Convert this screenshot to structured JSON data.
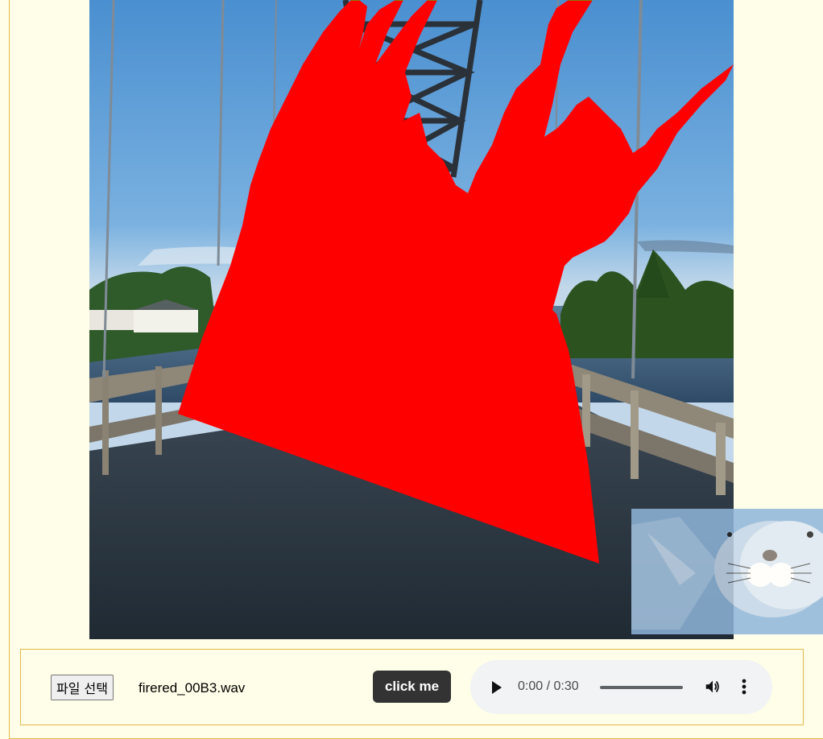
{
  "file_input": {
    "button_label": "파일 선택",
    "file_name": "firered_00B3.wav"
  },
  "action_button": {
    "label": "click me"
  },
  "audio_player": {
    "current_time": "0:00",
    "separator": "/",
    "duration": "0:30",
    "progress_fraction": 0.0,
    "play_icon": "play-icon",
    "volume_icon": "volume-icon",
    "menu_icon": "more-vert-icon"
  },
  "visualizer": {
    "background_scene": "bridge-photo",
    "gradient_top_color": "#00ff00",
    "gradient_bottom_color": "#ff0000"
  },
  "overlay": {
    "content": "seal-video-thumbnail"
  }
}
